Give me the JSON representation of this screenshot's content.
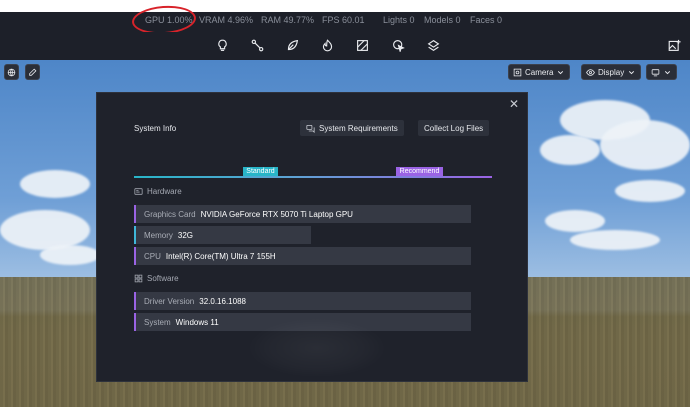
{
  "stats": {
    "gpu": "GPU 1.00%",
    "vram": "VRAM 4.96%",
    "ram": "RAM 49.77%",
    "fps": "FPS 60.01",
    "lights": "Lights 0",
    "models": "Models 0",
    "faces": "Faces 0"
  },
  "annotation_color": "#d8232a",
  "toolbar": {
    "icons": [
      "lightbulb-icon",
      "node-link-icon",
      "leaf-icon",
      "flame-icon",
      "texture-icon",
      "cursor-effect-icon",
      "layers-icon",
      "image-add-icon"
    ]
  },
  "viewport": {
    "camera_label": "Camera",
    "display_label": "Display"
  },
  "dialog": {
    "title": "System Info",
    "system_requirements": "System Requirements",
    "collect_logs": "Collect Log Files",
    "legend": {
      "standard": "Standard",
      "recommend": "Recommend",
      "standard_color": "#28b5c8",
      "recommend_color": "#9a63e4"
    },
    "hardware_title": "Hardware",
    "hardware": [
      {
        "key": "Graphics Card",
        "value": "NVIDIA GeForce RTX 5070 Ti Laptop GPU"
      },
      {
        "key": "Memory",
        "value": "32G"
      },
      {
        "key": "CPU",
        "value": "Intel(R) Core(TM) Ultra 7 155H"
      }
    ],
    "software_title": "Software",
    "software": [
      {
        "key": "Driver Version",
        "value": "32.0.16.1088"
      },
      {
        "key": "System",
        "value": "Windows 11"
      }
    ]
  }
}
